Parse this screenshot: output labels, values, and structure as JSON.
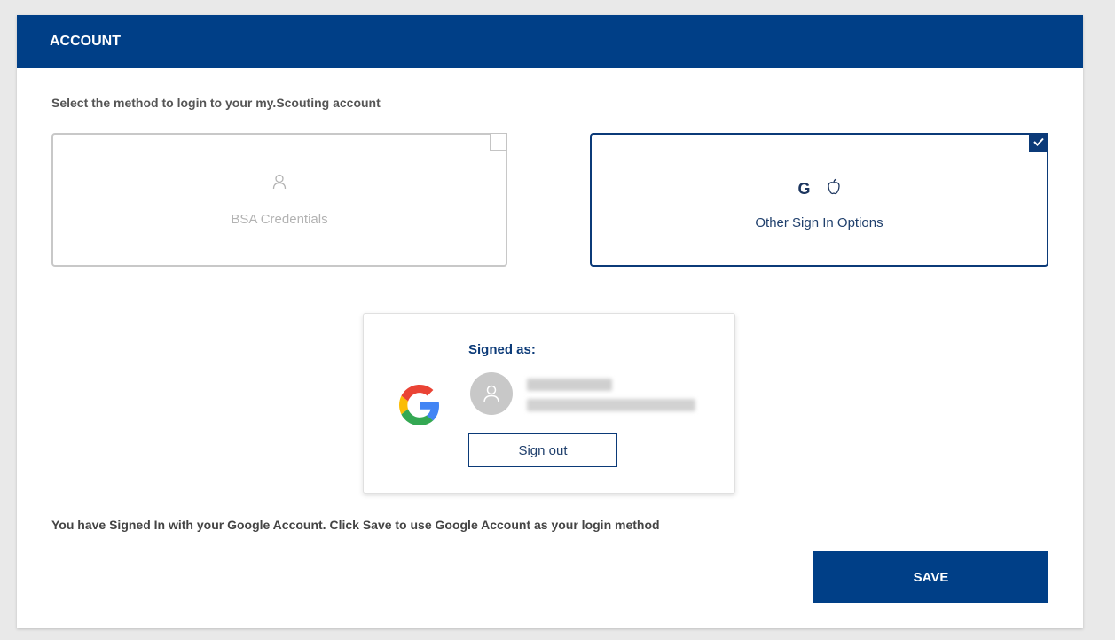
{
  "header": {
    "title": "ACCOUNT"
  },
  "instruction": "Select the method to login to your my.Scouting account",
  "options": [
    {
      "label": "BSA Credentials",
      "icon": "user-outline-icon",
      "selected": false
    },
    {
      "label": "Other Sign In Options",
      "icons": [
        "google-g-icon",
        "apple-icon"
      ],
      "selected": true,
      "google_letter": "G"
    }
  ],
  "signed_in": {
    "label": "Signed as:",
    "provider_icon": "google-logo-icon",
    "avatar_icon": "user-avatar-icon",
    "sign_out_label": "Sign out"
  },
  "footer_message": "You have Signed In with your Google Account. Click Save to use Google Account as your login method",
  "save_label": "SAVE",
  "colors": {
    "brand_blue": "#003f87",
    "accent_navy": "#0b3a78",
    "muted_gray": "#b3b3b3",
    "google_blue": "#4285F4",
    "google_red": "#EA4335",
    "google_yellow": "#FBBC05",
    "google_green": "#34A853"
  }
}
